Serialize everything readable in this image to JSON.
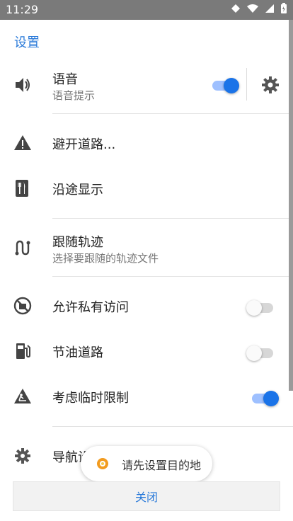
{
  "status_bar": {
    "time": "11:29"
  },
  "sheet": {
    "title": "设置"
  },
  "items": {
    "voice": {
      "label": "语音",
      "sub": "语音提示",
      "toggle": true
    },
    "avoid_roads": {
      "label": "避开道路..."
    },
    "show_along": {
      "label": "沿途显示"
    },
    "follow_track": {
      "label": "跟随轨迹",
      "sub": "选择要跟随的轨迹文件"
    },
    "private_access": {
      "label": "允许私有访问",
      "toggle": false
    },
    "fuel_roads": {
      "label": "节油道路",
      "toggle": false
    },
    "temp_limits": {
      "label": "考虑临时限制",
      "toggle": true
    },
    "nav_settings": {
      "label": "导航设"
    }
  },
  "toast": {
    "text": "请先设置目的地"
  },
  "close_button": {
    "label": "关闭"
  },
  "colors": {
    "accent": "#1a73e8",
    "link": "#2a7ad9",
    "statusbar": "#7a7a7a"
  }
}
